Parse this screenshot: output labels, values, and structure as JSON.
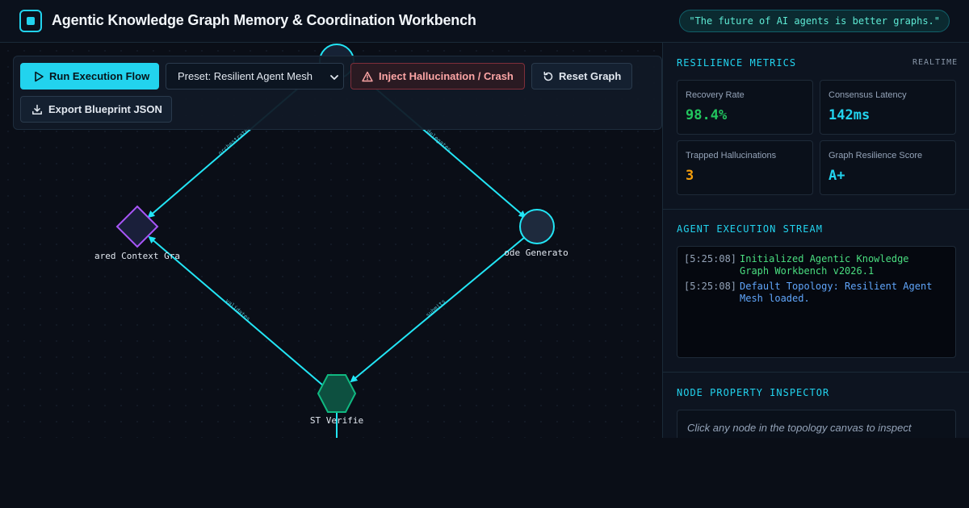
{
  "app": {
    "title": "Agentic Knowledge Graph Memory & Coordination Workbench",
    "quote": "\"The future of AI agents is better graphs.\""
  },
  "toolbar": {
    "run_label": "Run Execution Flow",
    "preset_label": "Preset: Resilient Agent Mesh",
    "inject_label": "Inject Hallucination / Crash",
    "reset_label": "Reset Graph",
    "export_label": "Export Blueprint JSON"
  },
  "graph": {
    "nodes": {
      "context": {
        "label": "ared Context Gra",
        "shape": "diamond"
      },
      "coder": {
        "label": "ode Generato",
        "shape": "circle"
      },
      "verifier": {
        "label": "ST Verifie",
        "shape": "hexagon"
      }
    },
    "edge_labels": {
      "top_left": "orchestrates",
      "top_right": "delegates",
      "bottom_left": "validates",
      "bottom_right": "submits"
    }
  },
  "metrics": {
    "title": "RESILIENCE METRICS",
    "badge": "REALTIME",
    "cards": [
      {
        "label": "Recovery Rate",
        "value": "98.4%",
        "color": "#22c55e"
      },
      {
        "label": "Consensus Latency",
        "value": "142ms",
        "color": "#22d3ee"
      },
      {
        "label": "Trapped Hallucinations",
        "value": "3",
        "color": "#f59e0b"
      },
      {
        "label": "Graph Resilience Score",
        "value": "A+",
        "color": "#22d3ee"
      }
    ]
  },
  "stream": {
    "title": "AGENT EXECUTION STREAM",
    "logs": [
      {
        "time": "[5:25:08]",
        "message": "Initialized Agentic Knowledge Graph Workbench v2026.1",
        "color": "#4ade80"
      },
      {
        "time": "[5:25:08]",
        "message": "Default Topology: Resilient Agent Mesh loaded.",
        "color": "#60a5fa"
      }
    ]
  },
  "inspector": {
    "title": "NODE PROPERTY INSPECTOR",
    "hint": "Click any node in the topology canvas to inspect"
  },
  "colors": {
    "accent": "#22d3ee",
    "edge": "#22e5f5",
    "context_node": "#a855f7",
    "verifier_node": "#10b981"
  }
}
